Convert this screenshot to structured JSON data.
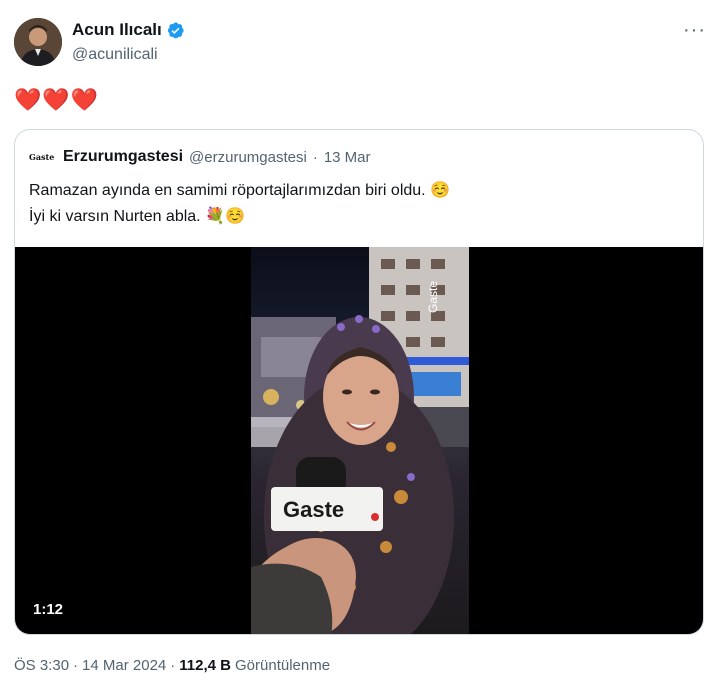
{
  "author": {
    "name": "Acun Ilıcalı",
    "handle": "@acunilicali",
    "verified": true,
    "avatar_icon": "person-portrait-icon"
  },
  "more_icon_label": "···",
  "tweet_text": "❤️❤️❤️",
  "quoted": {
    "logo_text": "Gaste",
    "name": "Erzurumgastesi",
    "handle": "@erzurumgastesi",
    "separator": "·",
    "date": "13 Mar",
    "lines": [
      "Ramazan ayında en samimi röportajlarımızdan biri oldu. ☺️",
      "İyi ki varsın Nurten abla. 💐☺️"
    ],
    "video": {
      "duration": "1:12",
      "sign_text": "Gaste",
      "mic_text": "Gaste"
    }
  },
  "footer": {
    "time": "ÖS 3:30",
    "sep1": "·",
    "date": "14 Mar 2024",
    "sep2": "·",
    "views_count": "112,4 B",
    "views_label": "Görüntülenme"
  },
  "colors": {
    "verified_blue": "#1d9bf0",
    "secondary_text": "#536471",
    "border": "#cfd9de"
  }
}
